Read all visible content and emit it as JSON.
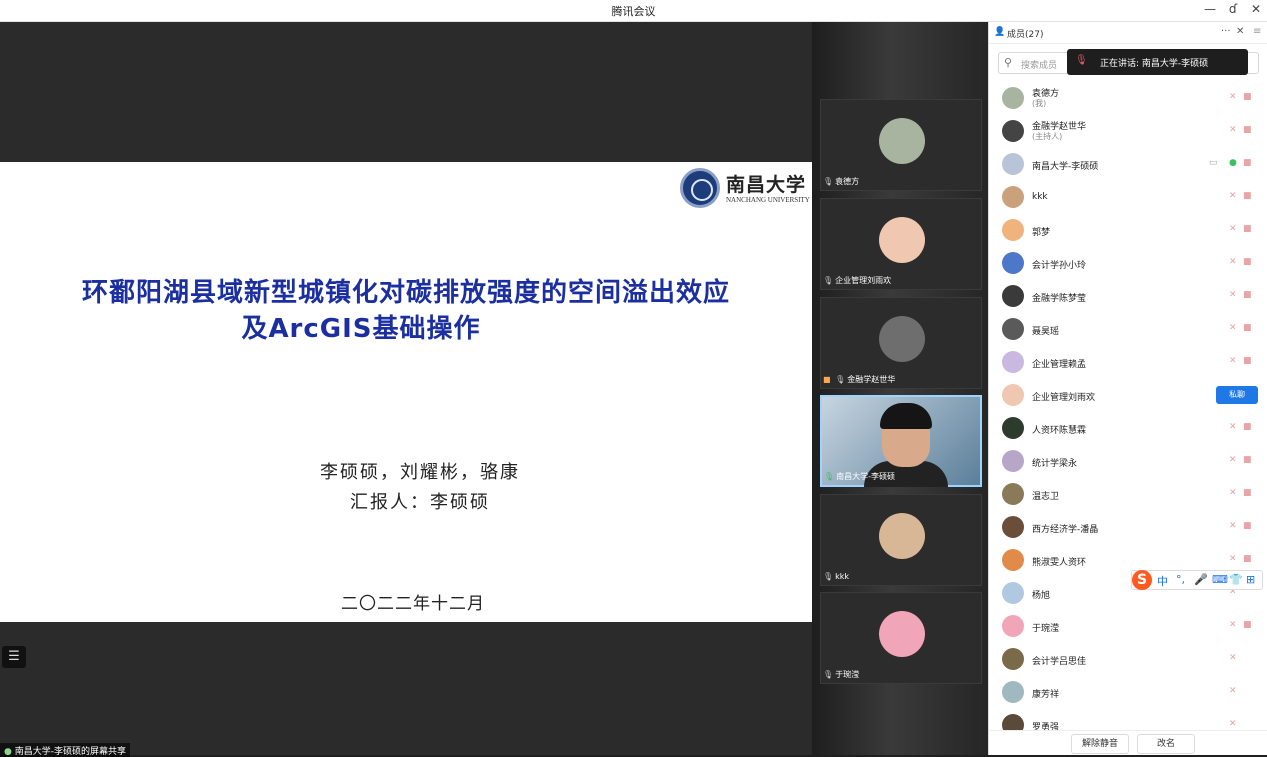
{
  "window": {
    "title": "腾讯会议",
    "min": "—",
    "max": "ɗ",
    "close": "✕"
  },
  "slide": {
    "logo_cn": "南昌大学",
    "logo_en": "NANCHANG UNIVERSITY",
    "title_line1": "环鄱阳湖县域新型城镇化对碳排放强度的空间溢出效应",
    "title_line2": "及ArcGIS基础操作",
    "authors": "李硕硕，刘耀彬，骆康",
    "reporter": "汇报人：李硕硕",
    "date": "二〇二二年十二月"
  },
  "share_label": "南昌大学-李硕硕的屏幕共享",
  "list_icon": "☰",
  "tiles": [
    {
      "name": "袁德方",
      "color": "#a8b4a0"
    },
    {
      "name": "企业管理刘雨欢",
      "color": "#f0c7b0"
    },
    {
      "name": "金融学赵世华",
      "color": "#6e6e6e"
    },
    {
      "name": "南昌大学-李硕硕",
      "color": "#d8a98a"
    },
    {
      "name": "kkk",
      "color": "#d7b795"
    },
    {
      "name": "于琬滢",
      "color": "#f0a6b8"
    }
  ],
  "panel": {
    "header_title": "成员(27)",
    "more": "···",
    "close": "✕",
    "menu": "≡",
    "search_placeholder": "搜索成员",
    "speaking": "正在讲话: 南昌大学-李硕硕",
    "chat_button": "私聊",
    "unmute_all": "解除静音",
    "rename": "改名"
  },
  "members": [
    {
      "name": "袁德方",
      "sub": "(我)",
      "color": "#a8b4a0"
    },
    {
      "name": "金融学赵世华",
      "sub": "(主持人)",
      "color": "#444444"
    },
    {
      "name": "南昌大学-李硕硕",
      "sub": "",
      "color": "#b8c4d8"
    },
    {
      "name": "kkk",
      "sub": "",
      "color": "#c9a27c"
    },
    {
      "name": "郭梦",
      "sub": "",
      "color": "#f0b37e"
    },
    {
      "name": "会计学孙小玲",
      "sub": "",
      "color": "#4d77c9"
    },
    {
      "name": "金融学陈梦莹",
      "sub": "",
      "color": "#3a3a3a"
    },
    {
      "name": "聂昊瑶",
      "sub": "",
      "color": "#5a5a5a"
    },
    {
      "name": "企业管理赖孟",
      "sub": "",
      "color": "#c9b8e0"
    },
    {
      "name": "企业管理刘雨欢",
      "sub": "",
      "color": "#f0c7b0"
    },
    {
      "name": "人资环陈慧霖",
      "sub": "",
      "color": "#2d3b2d"
    },
    {
      "name": "统计学梁永",
      "sub": "",
      "color": "#b7a6c8"
    },
    {
      "name": "温志卫",
      "sub": "",
      "color": "#8a7a5a"
    },
    {
      "name": "西方经济学-潘晶",
      "sub": "",
      "color": "#6b4e3a"
    },
    {
      "name": "熊淑雯人资环",
      "sub": "",
      "color": "#e08b4a"
    },
    {
      "name": "杨旭",
      "sub": "",
      "color": "#b0c8e0"
    },
    {
      "name": "于琬滢",
      "sub": "",
      "color": "#f0a6b8"
    },
    {
      "name": "会计学吕思佳",
      "sub": "",
      "color": "#7a6a4a"
    },
    {
      "name": "康芳祥",
      "sub": "",
      "color": "#a0b8c0"
    },
    {
      "name": "罗勇强",
      "sub": "",
      "color": "#5a4a3a"
    }
  ],
  "ime": {
    "logo": "S",
    "zh": "中",
    "punct": "°,",
    "mic": "🎤",
    "kbd": "⌨",
    "shirt": "👕",
    "grid": "⊞"
  }
}
